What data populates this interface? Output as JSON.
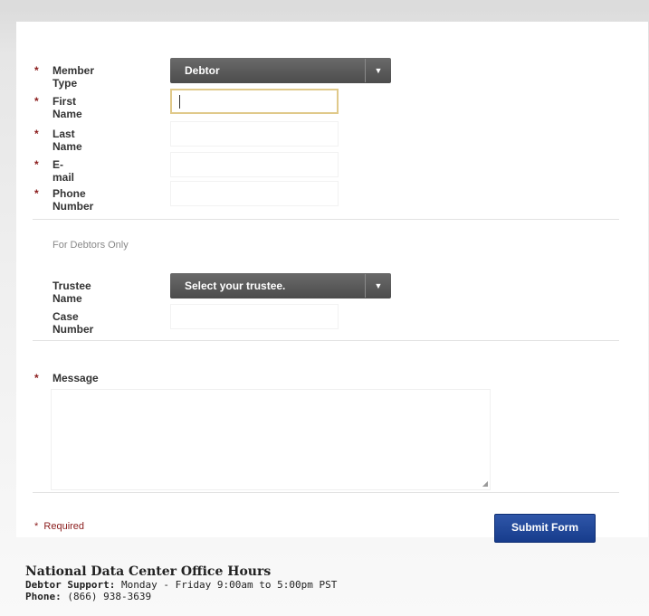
{
  "form": {
    "fields": {
      "member_type": {
        "label": "Member Type",
        "value": "Debtor"
      },
      "first_name": {
        "label": "First Name",
        "value": ""
      },
      "last_name": {
        "label": "Last Name",
        "value": ""
      },
      "email": {
        "label": "E-mail",
        "value": ""
      },
      "phone": {
        "label": "Phone Number",
        "value": ""
      }
    },
    "required_star": "*",
    "debtor_section": {
      "title": "For Debtors Only",
      "trustee": {
        "label": "Trustee Name",
        "value": "Select your trustee."
      },
      "case_number": {
        "label": "Case Number",
        "value": ""
      }
    },
    "message": {
      "label": "Message",
      "value": ""
    },
    "required_note": "Required",
    "submit_label": "Submit Form"
  },
  "icons": {
    "dropdown": "chevron-down-icon",
    "resize": "resize-handle-icon"
  },
  "footer": {
    "title": "National Data Center Office Hours",
    "debtor_support_label": "Debtor Support:",
    "debtor_support_value": "Monday - Friday 9:00am to 5:00pm PST",
    "phone_label": "Phone:",
    "phone_value": "(866) 938-3639"
  },
  "colors": {
    "required": "#8a1b1b",
    "submit": "#1f479a",
    "select": "#555555",
    "focus": "#e0c98a"
  }
}
